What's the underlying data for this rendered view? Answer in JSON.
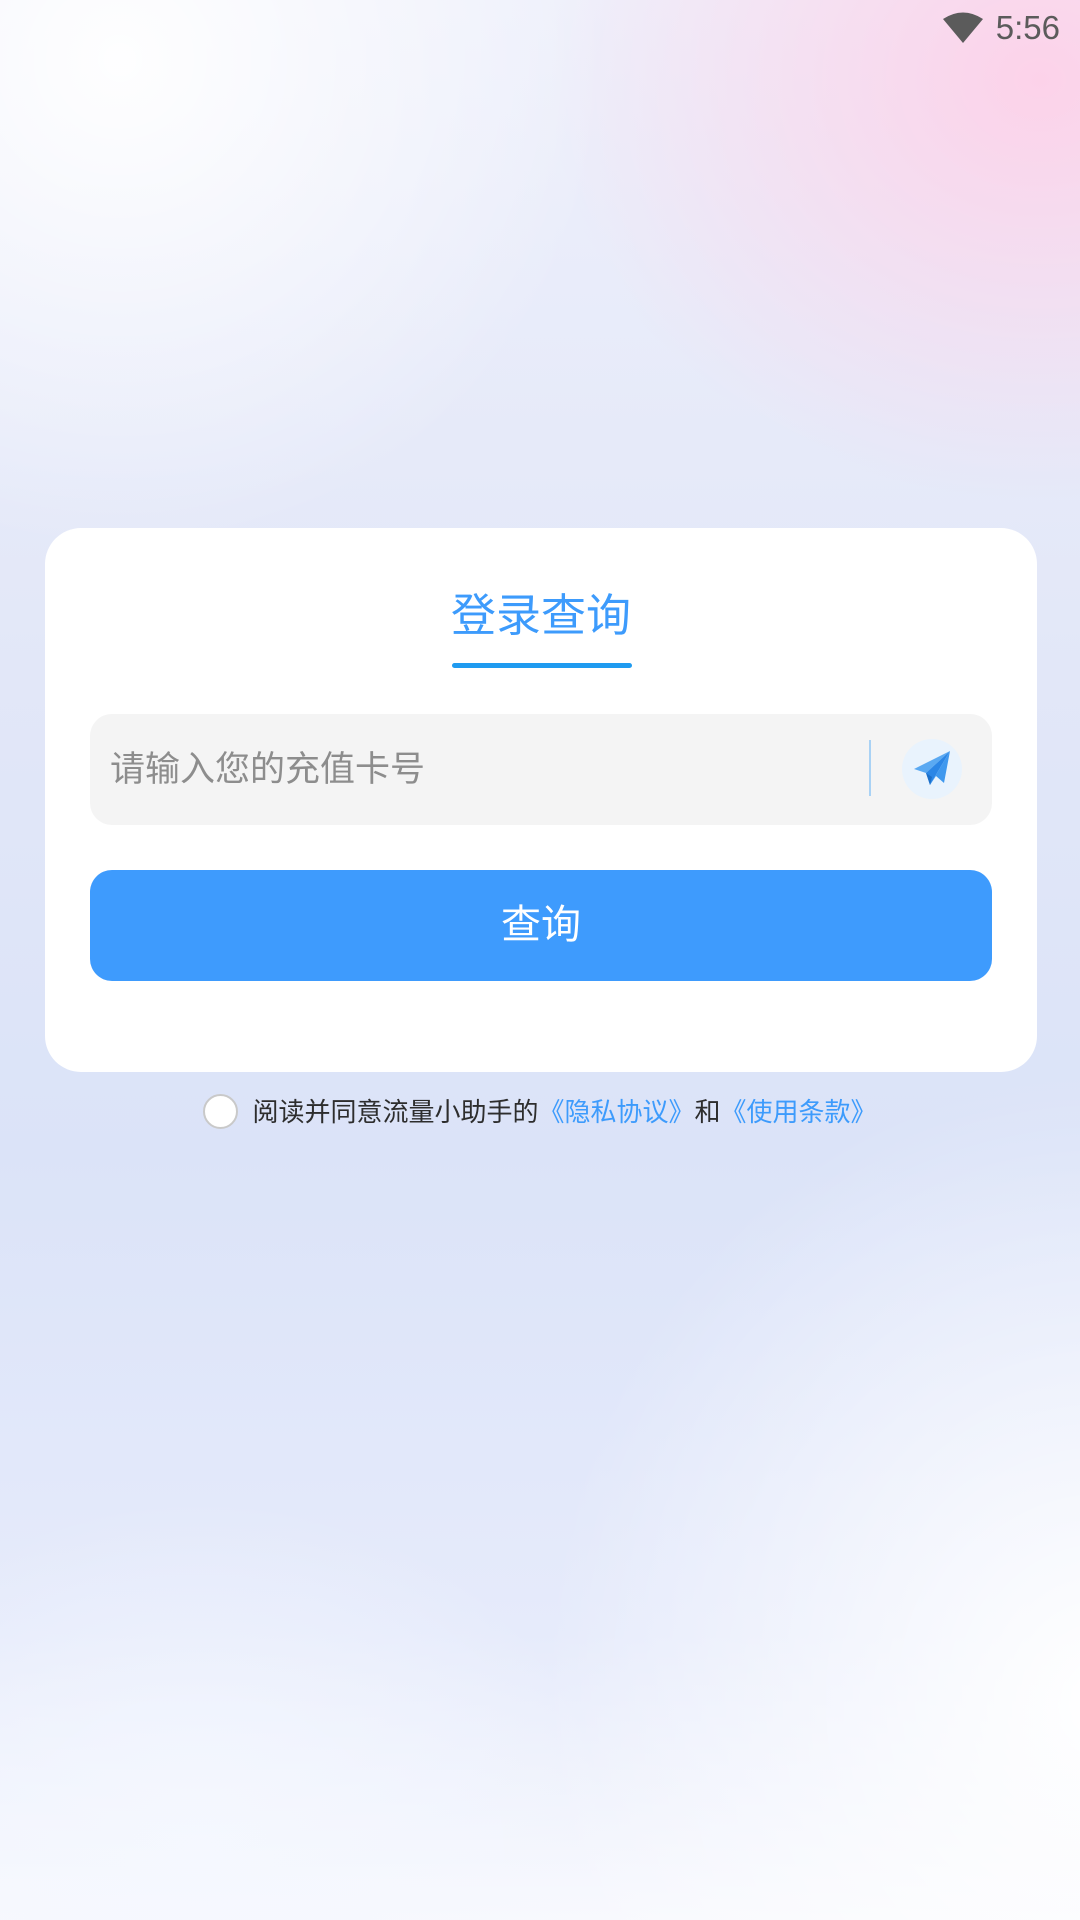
{
  "status_bar": {
    "time": "5:56",
    "icons": [
      "wifi-icon"
    ]
  },
  "login": {
    "tab_title": "登录查询",
    "card_input": {
      "value": "",
      "placeholder": "请输入您的充值卡号"
    },
    "send_icon": "paper-plane-icon",
    "query_button_label": "查询"
  },
  "agreement": {
    "checked": false,
    "prefix": "阅读并同意流量小助手的",
    "privacy_link": "《隐私协议》",
    "connector": "和",
    "terms_link": "《使用条款》"
  },
  "colors": {
    "accent": "#3e9bfd",
    "link": "#3d9bfc",
    "tab_underline": "#1f9bf0",
    "input_bg": "#f4f4f4",
    "placeholder": "#8d8d8d"
  }
}
